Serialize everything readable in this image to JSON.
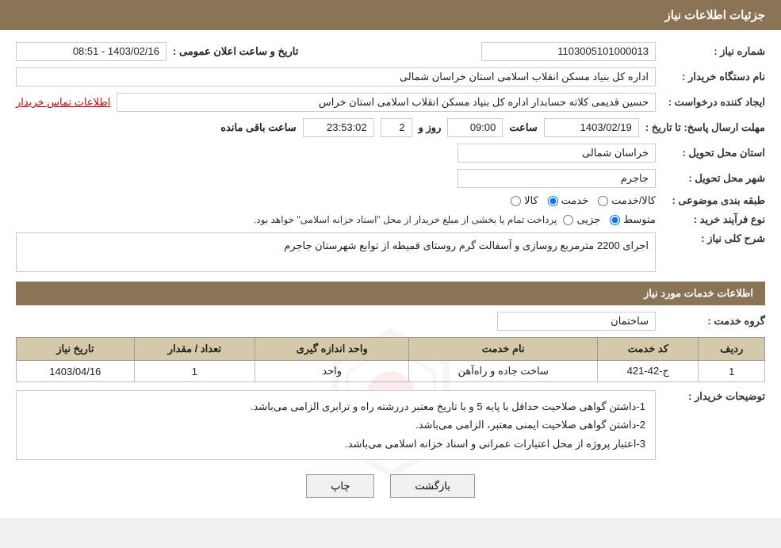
{
  "header": {
    "title": "جزئیات اطلاعات نیاز"
  },
  "fields": {
    "need_number_label": "شماره نیاز :",
    "need_number_value": "1103005101000013",
    "buyer_org_label": "نام دستگاه خریدار :",
    "buyer_org_value": "اداره کل بنیاد مسکن انقلاب اسلامی استان خراسان شمالی",
    "creator_label": "ایجاد کننده درخواست :",
    "creator_value": "حسین قدیمی کلاته حسابدار اداره کل بنیاد مسکن انقلاب اسلامی استان خراس",
    "creator_link": "اطلاعات تماس خریدار",
    "deadline_label": "مهلت ارسال پاسخ: تا تاریخ :",
    "deadline_date": "1403/02/19",
    "deadline_time_label": "ساعت",
    "deadline_time": "09:00",
    "deadline_day_label": "روز و",
    "deadline_day": "2",
    "deadline_remaining_label": "ساعت باقی مانده",
    "deadline_remaining": "23:53:02",
    "announce_label": "تاریخ و ساعت اعلان عمومی :",
    "announce_value": "1403/02/16 - 08:51",
    "province_label": "استان محل تحویل :",
    "province_value": "خراسان شمالی",
    "city_label": "شهر محل تحویل :",
    "city_value": "جاجرم",
    "subject_label": "طبقه بندی موضوعی :",
    "subject_options": [
      "کالا",
      "خدمت",
      "کالا/خدمت"
    ],
    "subject_selected": "خدمت",
    "process_label": "نوع فرآیند خرید :",
    "process_options": [
      "جزیی",
      "متوسط"
    ],
    "process_selected": "متوسط",
    "process_note": "پرداخت تمام یا بخشی از مبلغ خریدار از محل \"اسناد خزانه اسلامی\" خواهد بود.",
    "description_label": "شرح کلی نیاز :",
    "description_value": "اجرای 2200 مترمربع روسازی و آسفالت گرم روستای قمیطه از توابع شهرستان جاجرم"
  },
  "services_section": {
    "title": "اطلاعات خدمات مورد نیاز",
    "service_group_label": "گروه خدمت :",
    "service_group_value": "ساختمان",
    "table": {
      "columns": [
        "ردیف",
        "کد خدمت",
        "نام خدمت",
        "واحد اندازه گیری",
        "تعداد / مقدار",
        "تاریخ نیاز"
      ],
      "rows": [
        {
          "row": "1",
          "code": "ج-42-421",
          "name": "ساخت جاده و راه‌آهن",
          "unit": "واحد",
          "quantity": "1",
          "date": "1403/04/16"
        }
      ]
    },
    "notes_label": "توضیحات خریدار :",
    "notes": [
      "1-داشتن گواهی صلاحیت حداقل با پایه 5 و با تاریخ معتبر دررشته راه و ترابری الزامی می‌باشد.",
      "2-داشتن گواهی صلاحیت ایمنی معتبر، الزامی می‌باشد.",
      "3-اعتبار پروژه از محل اعتبارات عمرانی و اسناد خزانه اسلامی می‌باشد."
    ]
  },
  "buttons": {
    "back": "بازگشت",
    "print": "چاپ"
  }
}
